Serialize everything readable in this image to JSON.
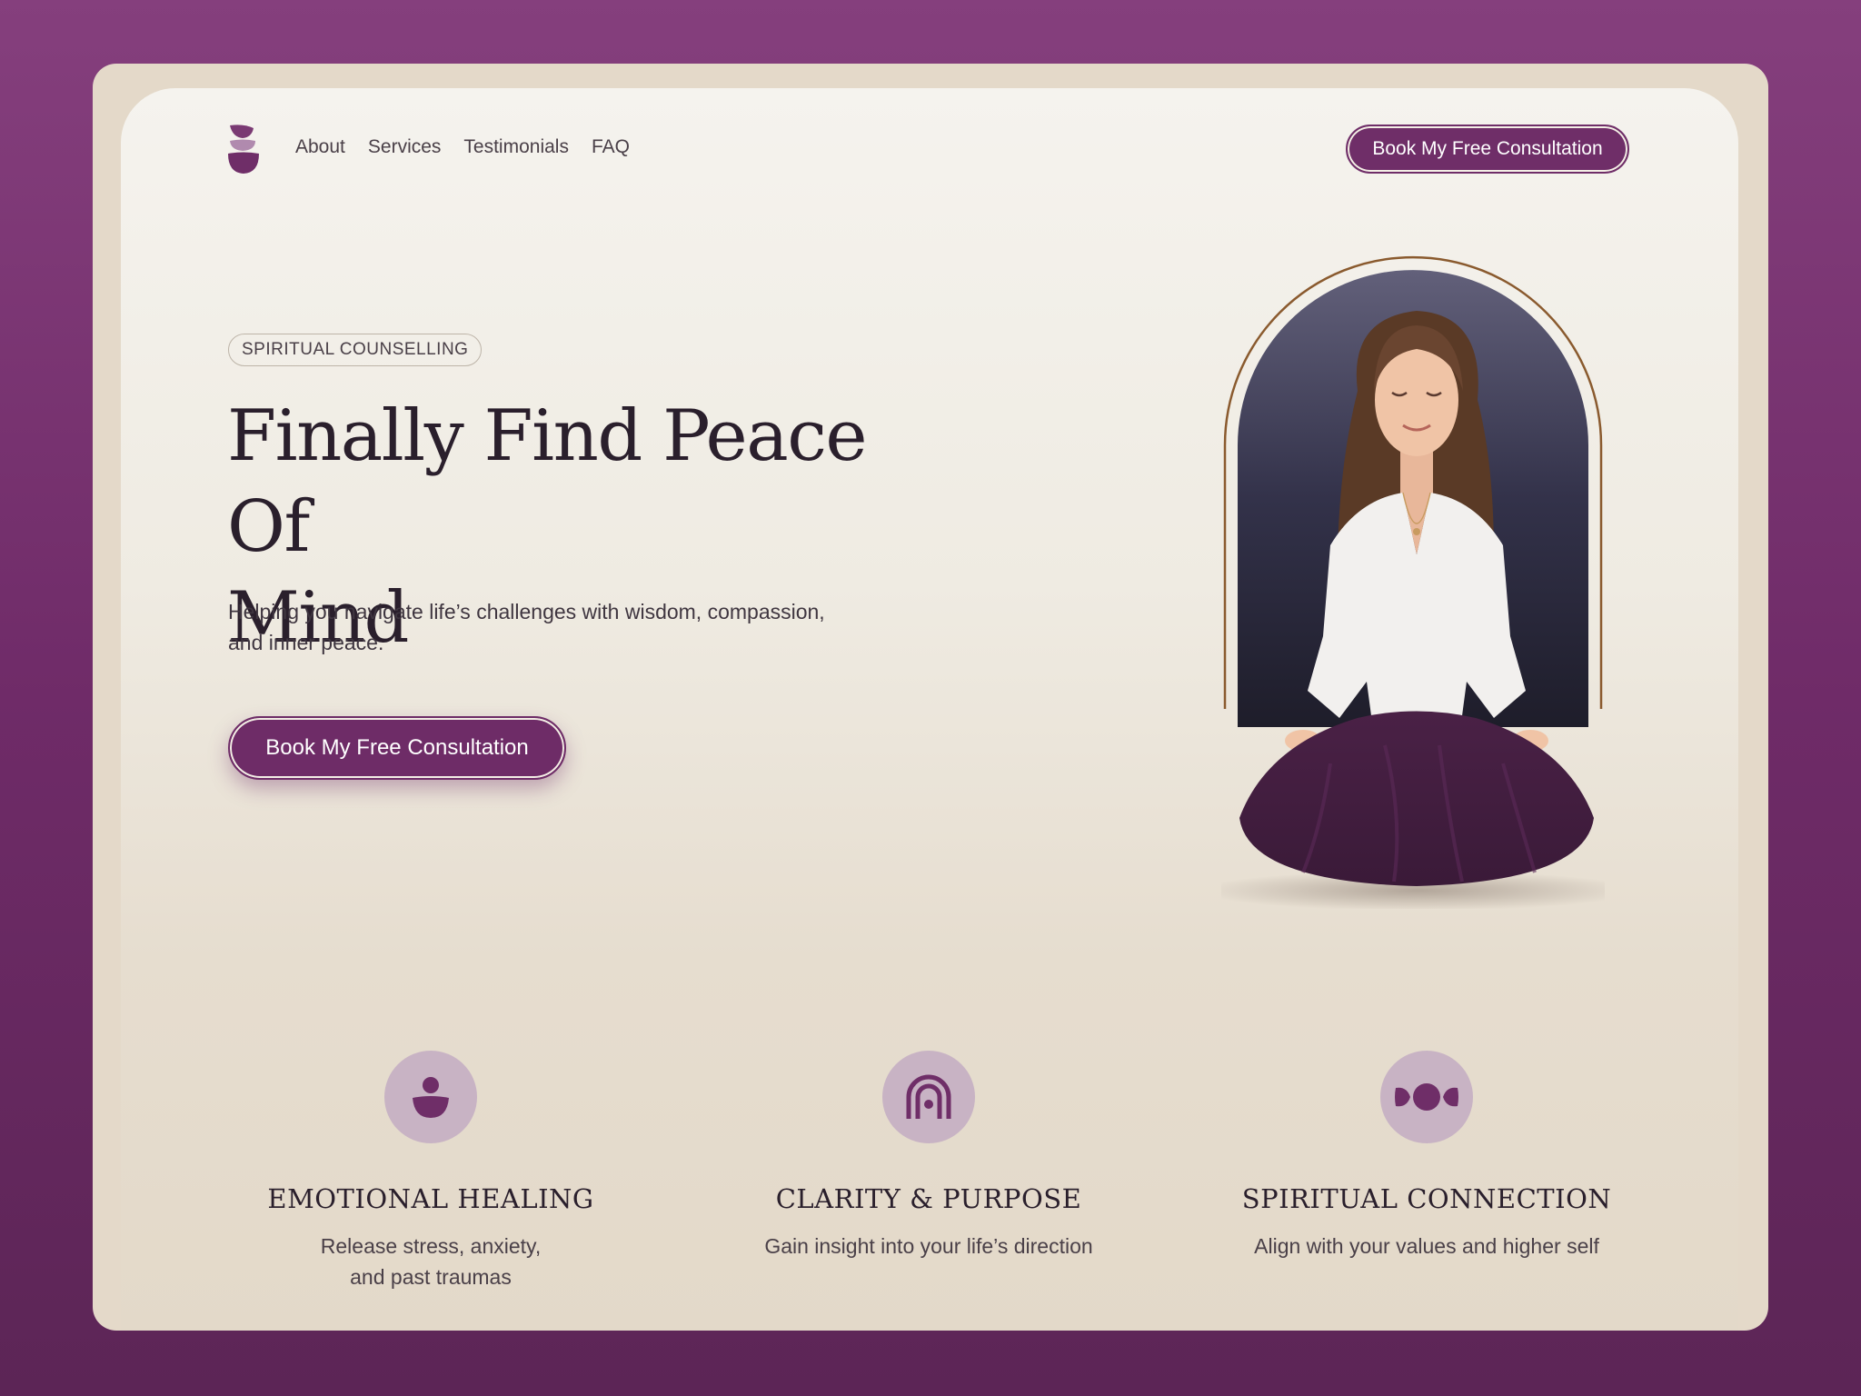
{
  "nav": {
    "logo": "stacked-stones-logo",
    "links": [
      "About",
      "Services",
      "Testimonials",
      "FAQ"
    ],
    "cta_label": "Book My Free Consultation"
  },
  "hero": {
    "tag": "SPIRITUAL COUNSELLING",
    "title_line1": "Finally Find Peace Of",
    "title_line2": "Mind",
    "subtitle_line1": "Helping you navigate life’s challenges with wisdom, compassion,",
    "subtitle_line2": "and inner peace.",
    "cta_label": "Book My Free Consultation",
    "image": "meditating-woman-illustration"
  },
  "features": [
    {
      "icon": "person-icon",
      "title": "EMOTIONAL HEALING",
      "text_line1": "Release stress, anxiety,",
      "text_line2": "and past traumas"
    },
    {
      "icon": "rainbow-arch-icon",
      "title": "CLARITY & PURPOSE",
      "text_line1": "Gain insight into your life’s direction",
      "text_line2": ""
    },
    {
      "icon": "connection-icon",
      "title": "SPIRITUAL CONNECTION",
      "text_line1": "Align with your values and higher self",
      "text_line2": ""
    }
  ],
  "colors": {
    "background": "#7a3572",
    "panel": "#f2eee6",
    "accent": "#6f2e68",
    "icon_circle": "#c8b3c4",
    "text_dark": "#2a1f2c"
  }
}
